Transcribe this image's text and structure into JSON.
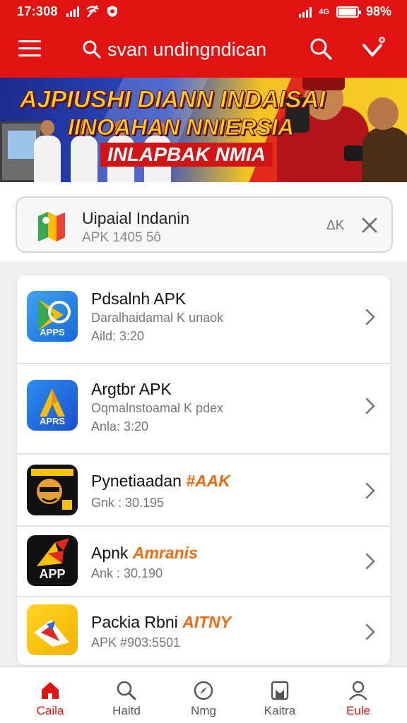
{
  "status_bar": {
    "time": "17:308",
    "network": "4G",
    "battery": "98%",
    "battery_level": 0.98
  },
  "header": {
    "title": "svan undingndican"
  },
  "banner": {
    "line1": "AJPIUSHI DIANN INDAISAI",
    "line2": "IINOAHAN NNIERSIA",
    "line3": "INLAPBAK NMIA"
  },
  "update_card": {
    "title": "Uipaial Indanin",
    "subtitle": "APK 1405 5ô",
    "size": "ΔK"
  },
  "apps": [
    {
      "title": "Pdsalnh APK",
      "accent": "",
      "desc": "Daralhaidamal K unaok",
      "date": "Aild: 3:20",
      "icon_label": "APPS"
    },
    {
      "title": "Argtbr APK",
      "accent": "",
      "desc": "Oqmalnstoamal K pdex",
      "date": "Anla: 3:20",
      "icon_label": "APRS"
    },
    {
      "title": "Pynetiaadan ",
      "accent": "#AAK",
      "desc": "Gnk : 30.195",
      "date": "",
      "icon_label": ""
    },
    {
      "title": "Apnk ",
      "accent": "Amranis",
      "desc": "Ank : 30.190",
      "date": "",
      "icon_label": "APP"
    },
    {
      "title": "Packia Rbni ",
      "accent": "AITNY",
      "desc": "APK #903:5501",
      "date": "",
      "icon_label": ""
    }
  ],
  "nav": [
    {
      "label": "Caila",
      "icon": "home-icon",
      "active": true
    },
    {
      "label": "Haitd",
      "icon": "search-icon",
      "active": false
    },
    {
      "label": "Nmg",
      "icon": "compass-icon",
      "active": false
    },
    {
      "label": "Kaitra",
      "icon": "bookmark-icon",
      "active": false
    },
    {
      "label": "Eule",
      "icon": "profile-icon",
      "active": false
    }
  ],
  "colors": {
    "primary": "#e31212",
    "accent": "#f06a12",
    "banner_yellow": "#f7d21e",
    "banner_blue": "#2a4bc7"
  }
}
